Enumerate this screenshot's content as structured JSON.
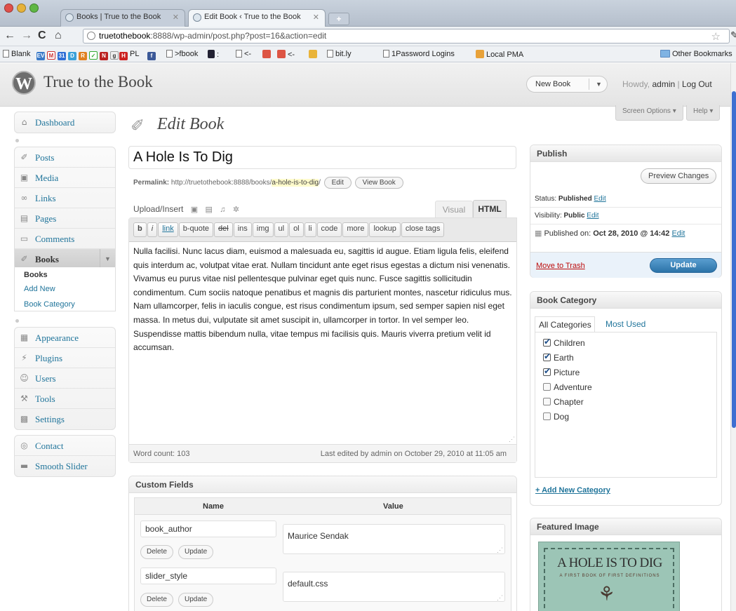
{
  "browser": {
    "tabs": [
      {
        "label": "Books | True to the Book"
      },
      {
        "label": "Edit Book ‹ True to the Book"
      }
    ],
    "url_host": "truetothebook",
    "url_path": ":8888/wp-admin/post.php?post=16&action=edit",
    "bookmarks": [
      "Blank",
      "PL",
      ">fbook",
      "<-",
      "<-",
      "bit.ly",
      "1Password Logins",
      "Local PMA",
      "Other Bookmarks"
    ]
  },
  "header": {
    "site_title": "True to the Book",
    "new_book": "New Book",
    "howdy_prefix": "Howdy,",
    "username": "admin",
    "separator": "|",
    "logout": "Log Out",
    "screen_options": "Screen Options",
    "help": "Help"
  },
  "menu": {
    "dashboard": "Dashboard",
    "posts": "Posts",
    "media": "Media",
    "links": "Links",
    "pages": "Pages",
    "comments": "Comments",
    "books": "Books",
    "books_sub": [
      "Books",
      "Add New",
      "Book Category"
    ],
    "appearance": "Appearance",
    "plugins": "Plugins",
    "users": "Users",
    "tools": "Tools",
    "settings": "Settings",
    "contact": "Contact",
    "smooth_slider": "Smooth Slider"
  },
  "editor": {
    "page_title": "Edit Book",
    "post_title": "A Hole Is To Dig",
    "permalink_label": "Permalink:",
    "permalink_base": "http://truetothebook:8888/books/",
    "permalink_slug": "a-hole-is-to-dig",
    "permalink_suffix": "/",
    "edit_btn": "Edit",
    "view_btn": "View Book",
    "upload_insert": "Upload/Insert",
    "tab_visual": "Visual",
    "tab_html": "HTML",
    "quicktags": [
      "b",
      "i",
      "link",
      "b-quote",
      "del",
      "ins",
      "img",
      "ul",
      "ol",
      "li",
      "code",
      "more",
      "lookup",
      "close tags"
    ],
    "content": "Nulla facilisi. Nunc lacus diam, euismod a malesuada eu, sagittis id augue. Etiam ligula felis, eleifend quis interdum ac, volutpat vitae erat. Nullam tincidunt ante eget risus egestas a dictum nisi venenatis. Vivamus eu purus vitae nisl pellentesque pulvinar eget quis nunc. Fusce sagittis sollicitudin condimentum. Cum sociis natoque penatibus et magnis dis parturient montes, nascetur ridiculus mus. Nam ullamcorper, felis in iaculis congue, est risus condimentum ipsum, sed semper sapien nisl eget massa. In metus dui, vulputate sit amet suscipit in, ullamcorper in tortor. In vel semper leo. Suspendisse mattis bibendum nulla, vitae tempus mi facilisis quis. Mauris viverra pretium velit id accumsan.",
    "word_count": "Word count: 103",
    "last_edited": "Last edited by admin on October 29, 2010 at 11:05 am"
  },
  "custom_fields": {
    "title": "Custom Fields",
    "col_name": "Name",
    "col_value": "Value",
    "rows": [
      {
        "key": "book_author",
        "value": "Maurice Sendak"
      },
      {
        "key": "slider_style",
        "value": "default.css"
      }
    ],
    "delete_btn": "Delete",
    "update_btn": "Update"
  },
  "publish": {
    "title": "Publish",
    "preview_btn": "Preview Changes",
    "status_label": "Status:",
    "status_value": "Published",
    "visibility_label": "Visibility:",
    "visibility_value": "Public",
    "published_on_label": "Published on:",
    "published_on_value": "Oct 28, 2010 @ 14:42",
    "edit_link": "Edit",
    "move_trash": "Move to Trash",
    "update_btn": "Update"
  },
  "book_category": {
    "title": "Book Category",
    "tab_all": "All Categories",
    "tab_used": "Most Used",
    "items": [
      {
        "label": "Children",
        "checked": true
      },
      {
        "label": "Earth",
        "checked": true
      },
      {
        "label": "Picture",
        "checked": true
      },
      {
        "label": "Adventure",
        "checked": false
      },
      {
        "label": "Chapter",
        "checked": false
      },
      {
        "label": "Dog",
        "checked": false
      }
    ],
    "add_new": "+ Add New Category"
  },
  "featured_image": {
    "title": "Featured Image",
    "cover_title": "A HOLE IS TO DIG",
    "cover_subtitle": "A FIRST BOOK OF FIRST DEFINITIONS"
  }
}
